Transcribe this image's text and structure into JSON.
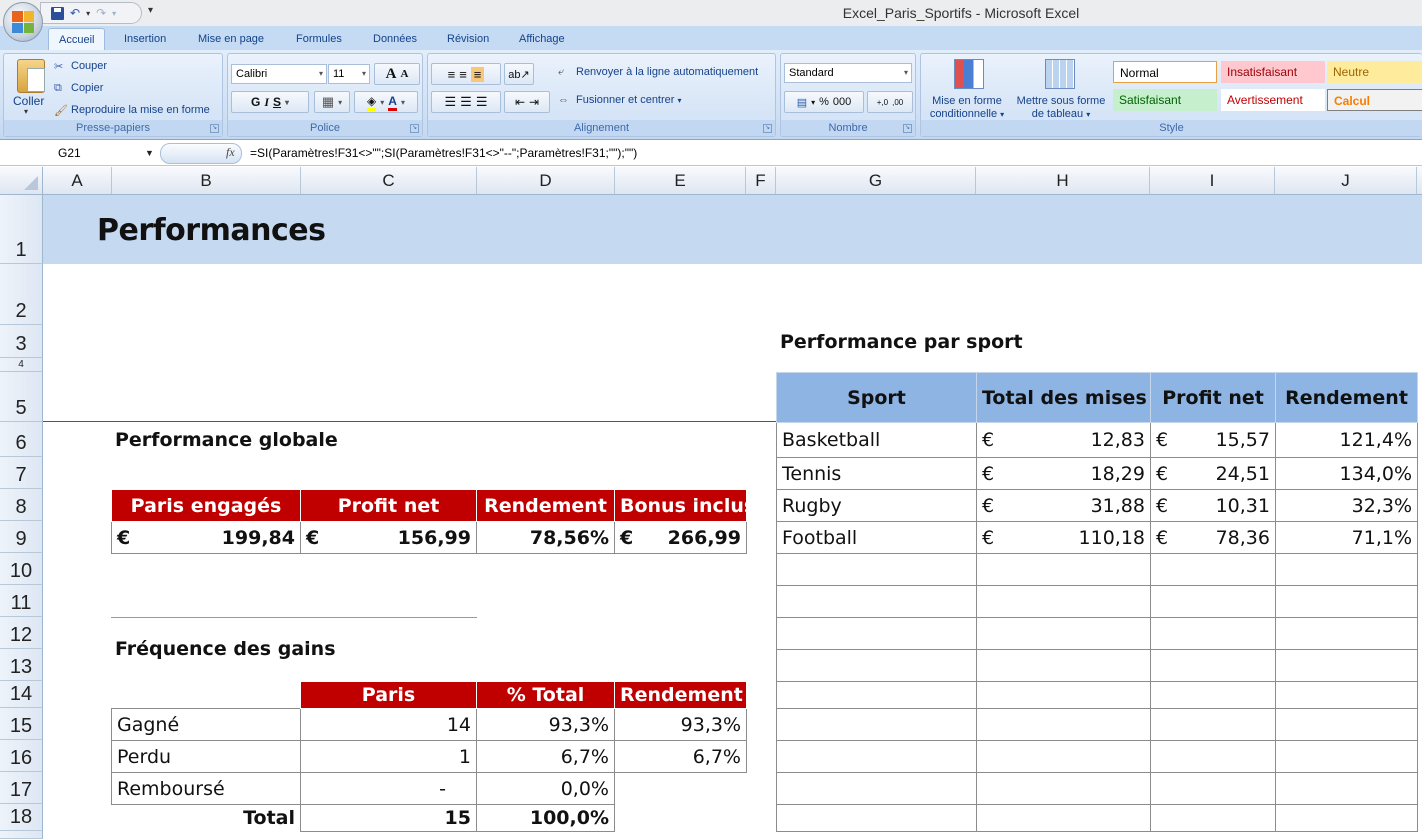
{
  "window": {
    "title": "Excel_Paris_Sportifs - Microsoft Excel"
  },
  "qat": {
    "save": "save-icon",
    "undo": "↶",
    "redo": "↷",
    "more": "▾"
  },
  "tabs": [
    {
      "label": "Accueil",
      "active": true
    },
    {
      "label": "Insertion"
    },
    {
      "label": "Mise en page"
    },
    {
      "label": "Formules"
    },
    {
      "label": "Données"
    },
    {
      "label": "Révision"
    },
    {
      "label": "Affichage"
    }
  ],
  "ribbon": {
    "clipboard": {
      "label": "Presse-papiers",
      "paste": "Coller",
      "cut": "Couper",
      "copy": "Copier",
      "format_painter": "Reproduire la mise en forme"
    },
    "font": {
      "label": "Police",
      "font_name": "Calibri",
      "font_size": "11",
      "grow": "A",
      "shrink": "A",
      "bold": "G",
      "italic": "I",
      "underline": "S",
      "font_color_accent": "#e00000",
      "fill_color_accent": "#ffff00"
    },
    "alignment": {
      "label": "Alignement",
      "wrap": "Renvoyer à la ligne automatiquement",
      "merge": "Fusionner et centrer"
    },
    "number": {
      "label": "Nombre",
      "format": "Standard",
      "percent": "%",
      "thousands": "000",
      "inc_decimal": "+,0",
      "dec_decimal": ",00"
    },
    "styles": {
      "label": "Style",
      "conditional": [
        "Mise en forme",
        "conditionnelle"
      ],
      "as_table": [
        "Mettre sous forme",
        "de tableau"
      ],
      "cells": [
        {
          "label": "Normal",
          "bg": "#ffffff",
          "color": "#000000"
        },
        {
          "label": "Insatisfaisant",
          "bg": "#ffc7ce",
          "color": "#9c0006"
        },
        {
          "label": "Neutre",
          "bg": "#ffeb9c",
          "color": "#9c6500"
        },
        {
          "label": "Satisfaisant",
          "bg": "#c6efce",
          "color": "#006100"
        },
        {
          "label": "Avertissement",
          "bg": "#ffffff",
          "color": "#c00000"
        },
        {
          "label": "Calcul",
          "bg": "#f2f2f2",
          "color": "#fa7d00"
        }
      ]
    }
  },
  "formula_bar": {
    "name_box": "G21",
    "fx": "fx",
    "formula": "=SI(Paramètres!F31<>\"\";SI(Paramètres!F31<>\"--\";Paramètres!F31;\"\");\"\")"
  },
  "columns": [
    "A",
    "B",
    "C",
    "D",
    "E",
    "F",
    "G",
    "H",
    "I",
    "J"
  ],
  "rows": [
    "1",
    "2",
    "3",
    "4",
    "5",
    "6",
    "7",
    "8",
    "9",
    "10",
    "11",
    "12",
    "13",
    "14",
    "15",
    "16",
    "17",
    "18"
  ],
  "sheet": {
    "title": "Performances",
    "global": {
      "title": "Performance globale",
      "headers": [
        "Paris engagés",
        "Profit net",
        "Rendement",
        "Bonus inclus"
      ],
      "currency": "€",
      "values": {
        "bets": "199,84",
        "profit": "156,99",
        "yield": "78,56%",
        "bonus": "266,99"
      }
    },
    "frequency": {
      "title": "Fréquence des gains",
      "headers": [
        "Paris",
        "% Total",
        "Rendement"
      ],
      "rows": [
        {
          "label": "Gagné",
          "bets": "14",
          "pct": "93,3%",
          "yield": "93,3%"
        },
        {
          "label": "Perdu",
          "bets": "1",
          "pct": "6,7%",
          "yield": "6,7%"
        },
        {
          "label": "Remboursé",
          "bets": "-",
          "pct": "0,0%",
          "yield": ""
        }
      ],
      "total": {
        "label": "Total",
        "bets": "15",
        "pct": "100,0%"
      }
    },
    "by_sport": {
      "title": "Performance par sport",
      "headers": [
        "Sport",
        "Total des mises",
        "Profit net",
        "Rendement"
      ],
      "currency": "€",
      "rows": [
        {
          "sport": "Basketball",
          "stakes": "12,83",
          "profit": "15,57",
          "yield": "121,4%"
        },
        {
          "sport": "Tennis",
          "stakes": "18,29",
          "profit": "24,51",
          "yield": "134,0%"
        },
        {
          "sport": "Rugby",
          "stakes": "31,88",
          "profit": "10,31",
          "yield": "32,3%"
        },
        {
          "sport": "Football",
          "stakes": "110,18",
          "profit": "78,36",
          "yield": "71,1%"
        }
      ]
    }
  }
}
